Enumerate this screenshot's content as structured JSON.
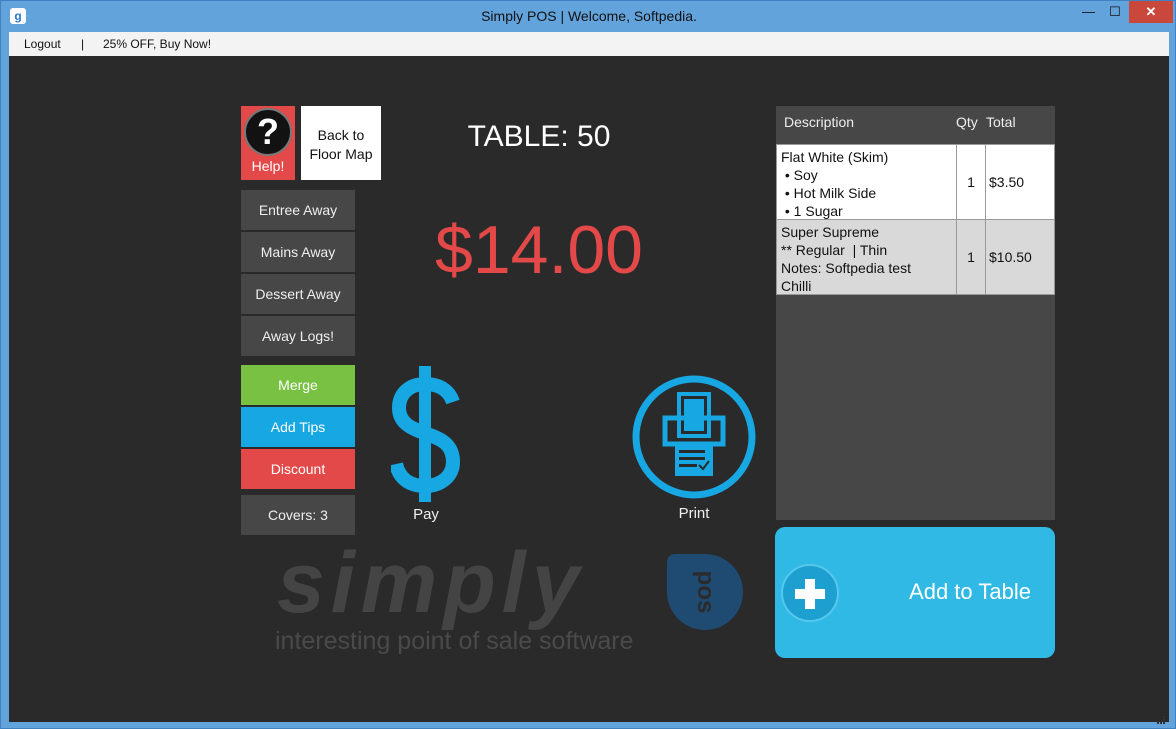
{
  "window": {
    "title": "Simply POS | Welcome, Softpedia.",
    "app_icon": "g",
    "controls": {
      "minimize": "—",
      "maximize": "☐",
      "close": "✕"
    }
  },
  "menu": {
    "logout": "Logout",
    "separator": "|",
    "promo": "25% OFF, Buy Now!"
  },
  "actions": {
    "help": {
      "symbol": "?",
      "label": "Help!"
    },
    "back": {
      "line1": "Back to",
      "line2": "Floor Map"
    },
    "entree_away": "Entree Away",
    "mains_away": "Mains Away",
    "dessert_away": "Dessert Away",
    "away_logs": "Away Logs!",
    "merge": "Merge",
    "add_tips": "Add Tips",
    "discount": "Discount",
    "covers": "Covers: 3"
  },
  "table": {
    "label": "TABLE: 50",
    "total": "$14.00"
  },
  "pay": {
    "label": "Pay",
    "icon": "dollar-icon"
  },
  "print": {
    "label": "Print",
    "icon": "printer-icon"
  },
  "branding": {
    "wordmark": "simply",
    "badge": "pos",
    "tagline": "interesting point of sale software"
  },
  "order": {
    "headers": {
      "description": "Description",
      "qty": "Qty",
      "total": "Total"
    },
    "items": [
      {
        "lines": [
          "Flat White (Skim)",
          " • Soy",
          " • Hot Milk Side",
          " • 1 Sugar"
        ],
        "qty": "1",
        "total": "$3.50"
      },
      {
        "lines": [
          "Super Supreme",
          "** Regular  | Thin",
          "Notes: Softpedia test",
          "Chilli"
        ],
        "qty": "1",
        "total": "$10.50"
      }
    ]
  },
  "add_to_table": {
    "label": "Add to Table",
    "icon": "plus-icon"
  },
  "colors": {
    "accent_blue": "#31b9e6",
    "alert_red": "#e34948",
    "merge_green": "#79c142",
    "background": "#2a2a2a"
  }
}
